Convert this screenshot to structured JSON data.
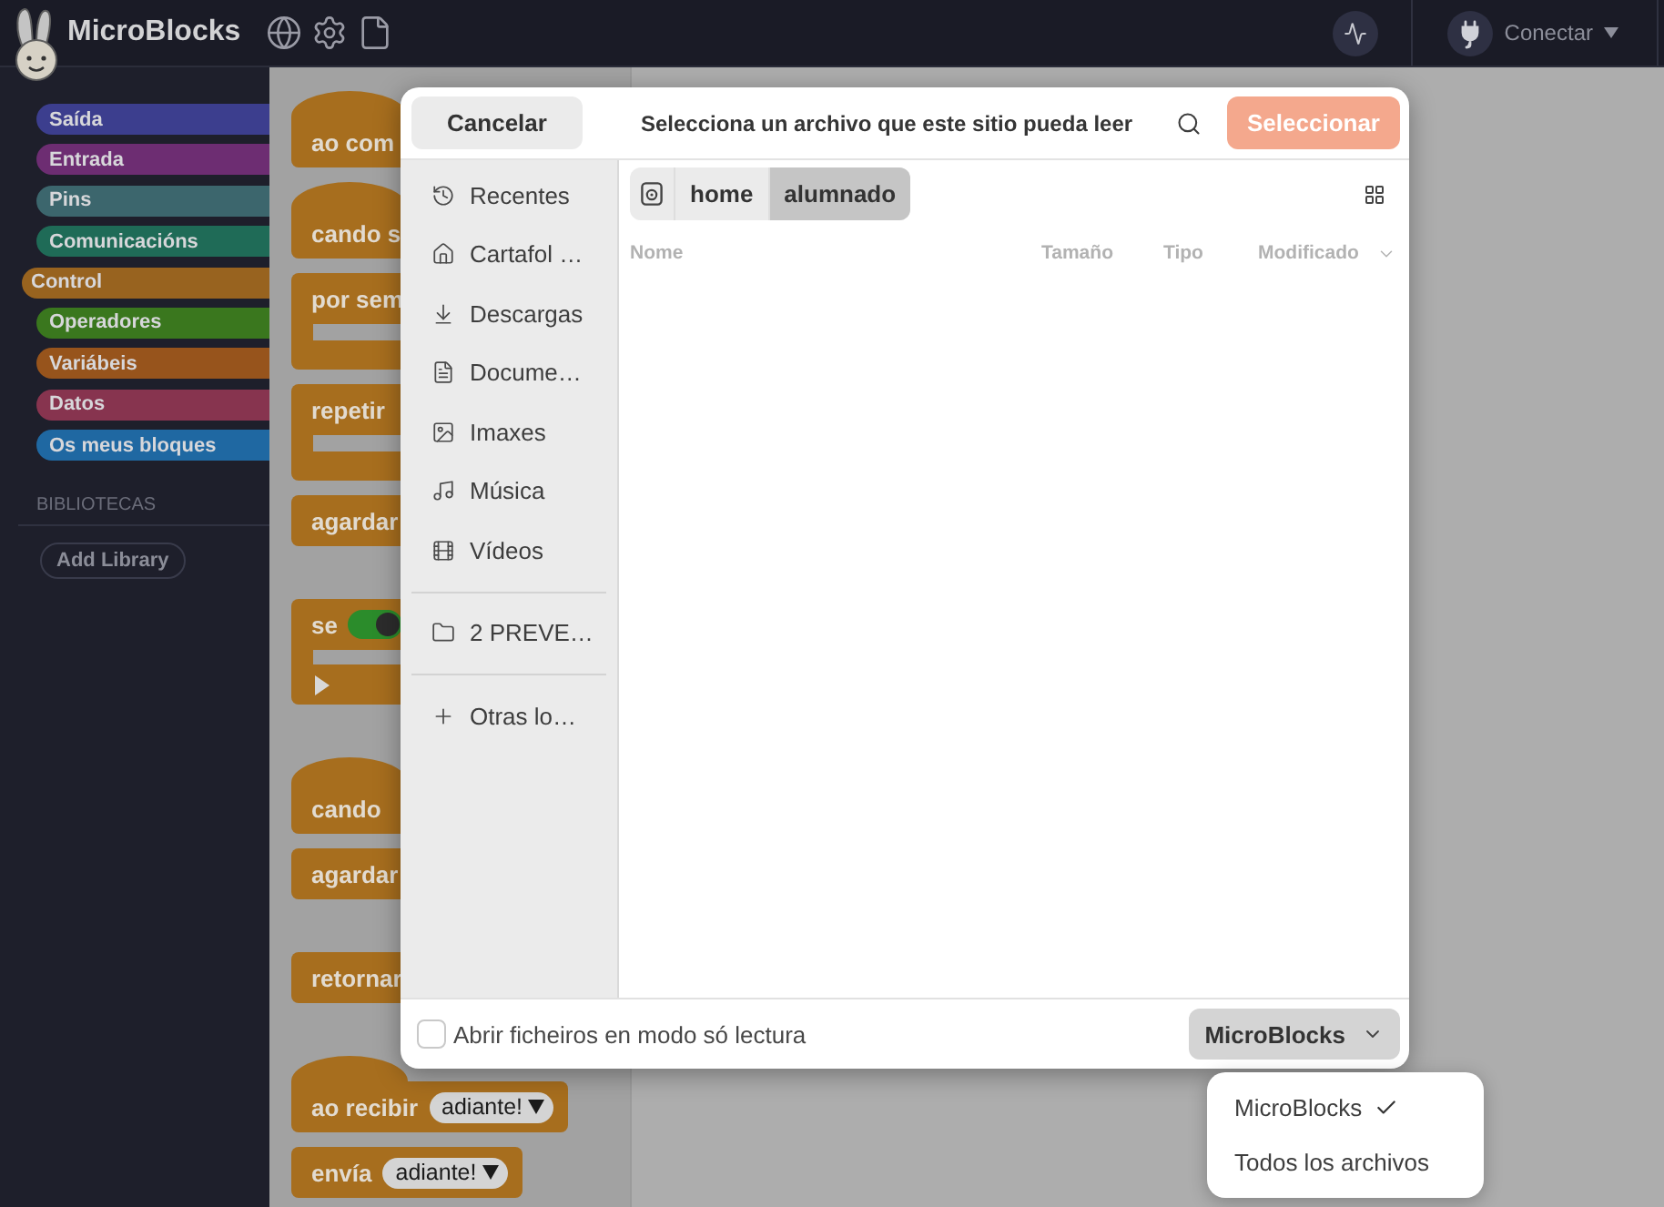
{
  "app": {
    "title": "MicroBlocks",
    "connect": "Conectar",
    "categories": [
      {
        "label": "Saída",
        "color": "#3c3e8e",
        "selected": false
      },
      {
        "label": "Entrada",
        "color": "#6d2d72",
        "selected": false
      },
      {
        "label": "Pins",
        "color": "#3c666d",
        "selected": false
      },
      {
        "label": "Comunicacións",
        "color": "#1f6b57",
        "selected": false
      },
      {
        "label": "Control",
        "color": "#98631f",
        "selected": true
      },
      {
        "label": "Operadores",
        "color": "#3a771e",
        "selected": false
      },
      {
        "label": "Variábeis",
        "color": "#97541c",
        "selected": false
      },
      {
        "label": "Datos",
        "color": "#87344f",
        "selected": false
      },
      {
        "label": "Os meus bloques",
        "color": "#1f68a2",
        "selected": false
      }
    ],
    "libraries": {
      "heading": "BIBLIOTECAS",
      "button": "Add Library"
    },
    "block_groups": [
      {
        "blocks": [
          {
            "kind": "hat",
            "label": "ao com"
          },
          {
            "kind": "hat",
            "label": "cando s"
          },
          {
            "kind": "loop",
            "label": "por sem"
          },
          {
            "kind": "loop",
            "label": "repetir"
          },
          {
            "kind": "command",
            "label": "agardar"
          }
        ]
      },
      {
        "blocks": [
          {
            "kind": "if",
            "label": "se",
            "toggle_on": true
          }
        ]
      },
      {
        "blocks": [
          {
            "kind": "hat",
            "label": "cando"
          },
          {
            "kind": "command",
            "label": "agardar"
          }
        ]
      },
      {
        "blocks": [
          {
            "kind": "command",
            "label": "retornar"
          }
        ]
      },
      {
        "blocks": [
          {
            "kind": "hat",
            "label": "ao recibir",
            "menu": "adiante!"
          },
          {
            "kind": "command",
            "label": "envía",
            "menu": "adiante!"
          }
        ]
      }
    ]
  },
  "dialog": {
    "cancel": "Cancelar",
    "title": "Selecciona un archivo que este sitio pueda leer",
    "confirm": {
      "label": "Seleccionar",
      "disabled": true
    },
    "place_groups": [
      {
        "places": [
          {
            "kind": "recent",
            "label": "Recentes"
          },
          {
            "kind": "home",
            "label": "Cartafol …"
          },
          {
            "kind": "downloads",
            "label": "Descargas"
          },
          {
            "kind": "documents",
            "label": "Docume…"
          },
          {
            "kind": "pictures",
            "label": "Imaxes"
          },
          {
            "kind": "music",
            "label": "Música"
          },
          {
            "kind": "videos",
            "label": "Vídeos"
          }
        ]
      },
      {
        "places": [
          {
            "kind": "folder",
            "label": "2 PREVE…"
          }
        ]
      },
      {
        "places": [
          {
            "kind": "other",
            "label": "Otras lo…"
          }
        ]
      }
    ],
    "path": [
      {
        "kind": "drive",
        "selected": false
      },
      {
        "kind": "folder",
        "label": "home",
        "selected": false
      },
      {
        "kind": "folder",
        "label": "alumnado",
        "selected": true
      }
    ],
    "columns": [
      {
        "label": "Nome",
        "sorted": false
      },
      {
        "label": "Tamaño",
        "sorted": false
      },
      {
        "label": "Tipo",
        "sorted": false
      },
      {
        "label": "Modificado",
        "sorted": true
      }
    ],
    "read_only": {
      "label": "Abrir ficheiros en modo só lectura",
      "checked": false
    },
    "filter": {
      "label": "MicroBlocks",
      "expanded": true
    },
    "filter_menu": [
      {
        "label": "MicroBlocks",
        "selected": true
      },
      {
        "label": "Todos los archivos",
        "selected": false
      }
    ]
  }
}
